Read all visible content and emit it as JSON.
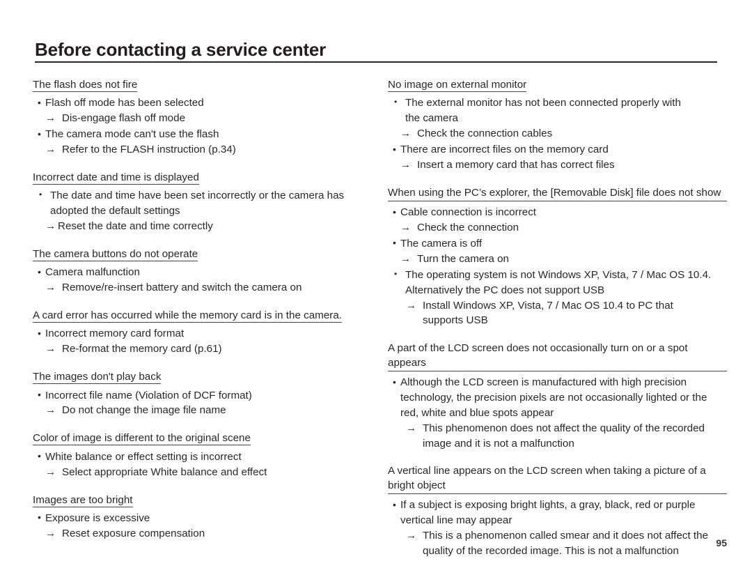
{
  "header": {
    "title": "Before contacting a service center"
  },
  "page_number": "95",
  "left_column": [
    {
      "heading": "The flash does not fire",
      "items": [
        {
          "type": "bullet",
          "text": "Flash off mode has been selected"
        },
        {
          "type": "arrow",
          "text": "Dis-engage flash off mode"
        },
        {
          "type": "bullet",
          "text": "The camera mode can't use the flash"
        },
        {
          "type": "arrow",
          "text": "Refer to the FLASH instruction (p.34)"
        }
      ]
    },
    {
      "heading": "Incorrect date and time is displayed",
      "items": [
        {
          "type": "bullet-wide",
          "text": "The date and time have been set incorrectly or the camera has",
          "cont": "adopted the default settings"
        },
        {
          "type": "arrow-tight",
          "text": "Reset the date and time correctly"
        }
      ]
    },
    {
      "heading": "The camera buttons do not operate",
      "items": [
        {
          "type": "bullet",
          "text": "Camera malfunction"
        },
        {
          "type": "arrow",
          "text": "Remove/re-insert battery and switch the camera on"
        }
      ]
    },
    {
      "heading": "A card error has occurred while the memory card is in the camera.",
      "items": [
        {
          "type": "bullet",
          "text": "Incorrect memory card format"
        },
        {
          "type": "arrow",
          "text": "Re-format the memory card (p.61)"
        }
      ]
    },
    {
      "heading": "The images don't play back",
      "items": [
        {
          "type": "bullet",
          "text": "Incorrect file name (Violation of DCF format)"
        },
        {
          "type": "arrow",
          "text": "Do not change the image file name"
        }
      ]
    },
    {
      "heading": "Color of image is different to the original scene",
      "items": [
        {
          "type": "bullet",
          "text": "White balance or effect setting is incorrect"
        },
        {
          "type": "arrow",
          "text": "Select appropriate White balance and effect"
        }
      ]
    },
    {
      "heading": "Images are too bright",
      "items": [
        {
          "type": "bullet",
          "text": "Exposure is excessive"
        },
        {
          "type": "arrow",
          "text": "Reset exposure compensation"
        }
      ]
    }
  ],
  "right_column": [
    {
      "heading": "No image on external monitor",
      "items": [
        {
          "type": "bullet-wide",
          "text": "The external monitor has not been connected properly with",
          "cont": "the camera"
        },
        {
          "type": "arrow",
          "text": "Check the connection cables"
        },
        {
          "type": "bullet",
          "text": "There are incorrect files on the memory card"
        },
        {
          "type": "arrow",
          "text": "Insert a memory card that has correct files"
        }
      ]
    },
    {
      "heading": "When using the PC’s explorer, the [Removable Disk] file does not show",
      "heading_full": true,
      "items": [
        {
          "type": "bullet",
          "text": "Cable connection is incorrect"
        },
        {
          "type": "arrow",
          "text": "Check the connection"
        },
        {
          "type": "bullet",
          "text": "The camera is off"
        },
        {
          "type": "arrow",
          "text": "Turn the camera on"
        },
        {
          "type": "bullet-wide",
          "text": "The operating system is not Windows XP, Vista, 7 / Mac OS 10.4.",
          "cont": "Alternatively the PC does not support USB"
        },
        {
          "type": "arrow-deep",
          "text": "Install Windows XP, Vista, 7 / Mac OS 10.4 to PC that",
          "cont": "supports USB"
        }
      ]
    },
    {
      "heading": "A part of the LCD screen does not occasionally turn on or a spot appears",
      "heading_full": true,
      "items": [
        {
          "type": "bullet",
          "text": "Although the LCD screen is manufactured with high precision",
          "cont": "technology, the precision pixels are not occasionally lighted or the",
          "cont2": "red, white and blue spots appear"
        },
        {
          "type": "arrow-deep",
          "text": "This phenomenon does not affect the quality of the recorded",
          "cont": "image and it is not a malfunction"
        }
      ]
    },
    {
      "heading": "A vertical line appears on the LCD screen when taking a picture of a bright object",
      "heading_full": true,
      "items": [
        {
          "type": "bullet",
          "text": "If a subject is exposing bright lights, a gray, black, red or purple",
          "cont": "vertical line may appear"
        },
        {
          "type": "arrow-deep",
          "text": "This is a phenomenon called smear and it does not affect the",
          "cont": "quality of the recorded image. This is not a malfunction"
        }
      ]
    }
  ]
}
